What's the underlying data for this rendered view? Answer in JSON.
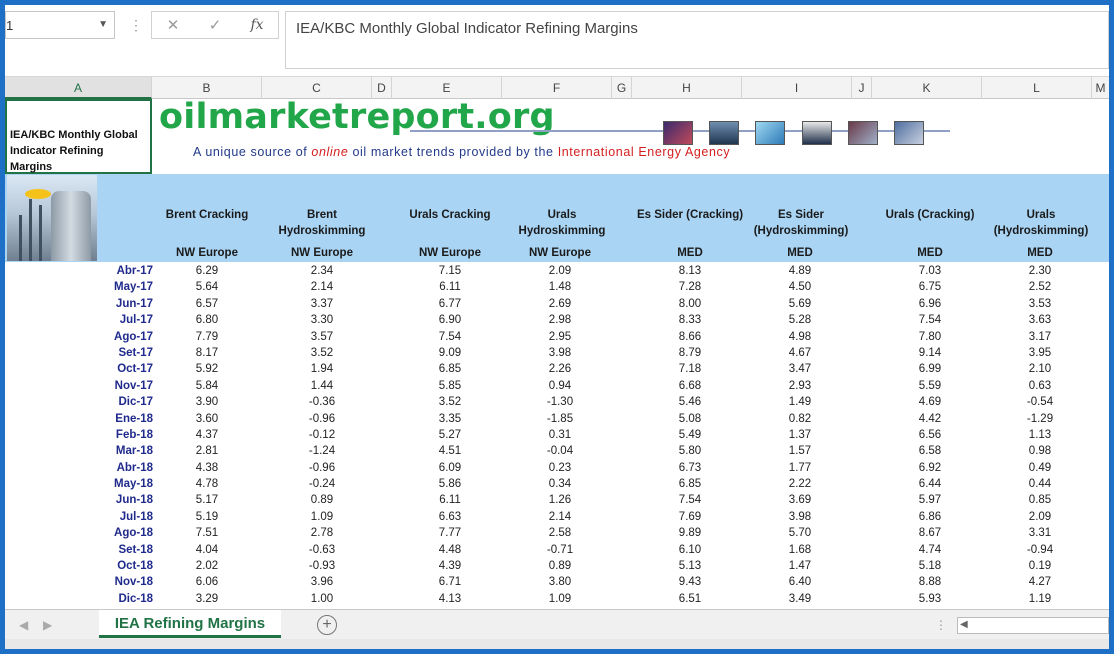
{
  "name_box": "1",
  "formula": "IEA/KBC Monthly Global Indicator Refining Margins",
  "fx_label": "fx",
  "columns": [
    "A",
    "B",
    "C",
    "D",
    "E",
    "F",
    "G",
    "H",
    "I",
    "J",
    "K",
    "L",
    "M"
  ],
  "a1_text": "IEA/KBC Monthly Global Indicator Refining Margins",
  "logo_text": "oilmarketreport.org",
  "tagline": {
    "pre": "A unique source of ",
    "italic": "online",
    "mid": " oil market trends provided by the ",
    "org": "International Energy Agency"
  },
  "headers": [
    {
      "l1": "",
      "l2": "Brent Cracking",
      "sub": "NW Europe"
    },
    {
      "l1": "Brent",
      "l2": "Hydroskimming",
      "sub": "NW Europe"
    },
    {
      "l1": "",
      "l2": "Urals Cracking",
      "sub": "NW Europe"
    },
    {
      "l1": "Urals",
      "l2": "Hydroskimming",
      "sub": "NW Europe"
    },
    {
      "l1": "",
      "l2": "Es Sider (Cracking)",
      "sub": "MED"
    },
    {
      "l1": "Es Sider",
      "l2": "(Hydroskimming)",
      "sub": "MED"
    },
    {
      "l1": "",
      "l2": "Urals (Cracking)",
      "sub": "MED"
    },
    {
      "l1": "Urals",
      "l2": "(Hydroskimming)",
      "sub": "MED"
    }
  ],
  "rows": [
    [
      "Abr-17",
      "6.29",
      "2.34",
      "7.15",
      "2.09",
      "8.13",
      "4.89",
      "7.03",
      "2.30"
    ],
    [
      "May-17",
      "5.64",
      "2.14",
      "6.11",
      "1.48",
      "7.28",
      "4.50",
      "6.75",
      "2.52"
    ],
    [
      "Jun-17",
      "6.57",
      "3.37",
      "6.77",
      "2.69",
      "8.00",
      "5.69",
      "6.96",
      "3.53"
    ],
    [
      "Jul-17",
      "6.80",
      "3.30",
      "6.90",
      "2.98",
      "8.33",
      "5.28",
      "7.54",
      "3.63"
    ],
    [
      "Ago-17",
      "7.79",
      "3.57",
      "7.54",
      "2.95",
      "8.66",
      "4.98",
      "7.80",
      "3.17"
    ],
    [
      "Set-17",
      "8.17",
      "3.52",
      "9.09",
      "3.98",
      "8.79",
      "4.67",
      "9.14",
      "3.95"
    ],
    [
      "Oct-17",
      "5.92",
      "1.94",
      "6.85",
      "2.26",
      "7.18",
      "3.47",
      "6.99",
      "2.10"
    ],
    [
      "Nov-17",
      "5.84",
      "1.44",
      "5.85",
      "0.94",
      "6.68",
      "2.93",
      "5.59",
      "0.63"
    ],
    [
      "Dic-17",
      "3.90",
      "-0.36",
      "3.52",
      "-1.30",
      "5.46",
      "1.49",
      "4.69",
      "-0.54"
    ],
    [
      "Ene-18",
      "3.60",
      "-0.96",
      "3.35",
      "-1.85",
      "5.08",
      "0.82",
      "4.42",
      "-1.29"
    ],
    [
      "Feb-18",
      "4.37",
      "-0.12",
      "5.27",
      "0.31",
      "5.49",
      "1.37",
      "6.56",
      "1.13"
    ],
    [
      "Mar-18",
      "2.81",
      "-1.24",
      "4.51",
      "-0.04",
      "5.80",
      "1.57",
      "6.58",
      "0.98"
    ],
    [
      "Abr-18",
      "4.38",
      "-0.96",
      "6.09",
      "0.23",
      "6.73",
      "1.77",
      "6.92",
      "0.49"
    ],
    [
      "May-18",
      "4.78",
      "-0.24",
      "5.86",
      "0.34",
      "6.85",
      "2.22",
      "6.44",
      "0.44"
    ],
    [
      "Jun-18",
      "5.17",
      "0.89",
      "6.11",
      "1.26",
      "7.54",
      "3.69",
      "5.97",
      "0.85"
    ],
    [
      "Jul-18",
      "5.19",
      "1.09",
      "6.63",
      "2.14",
      "7.69",
      "3.98",
      "6.86",
      "2.09"
    ],
    [
      "Ago-18",
      "7.51",
      "2.78",
      "7.77",
      "2.58",
      "9.89",
      "5.70",
      "8.67",
      "3.31"
    ],
    [
      "Set-18",
      "4.04",
      "-0.63",
      "4.48",
      "-0.71",
      "6.10",
      "1.68",
      "4.74",
      "-0.94"
    ],
    [
      "Oct-18",
      "2.02",
      "-0.93",
      "4.39",
      "0.89",
      "5.13",
      "1.47",
      "5.18",
      "0.19"
    ],
    [
      "Nov-18",
      "6.06",
      "3.96",
      "6.71",
      "3.80",
      "9.43",
      "6.40",
      "8.88",
      "4.27"
    ],
    [
      "Dic-18",
      "3.29",
      "1.00",
      "4.13",
      "1.09",
      "6.51",
      "3.49",
      "5.93",
      "1.19"
    ]
  ],
  "sheet_tab": "IEA Refining Margins",
  "colors": {
    "accent": "#217346",
    "band": "#a9d4f4",
    "frame": "#1e6fc6",
    "month": "#1f2a8c"
  }
}
